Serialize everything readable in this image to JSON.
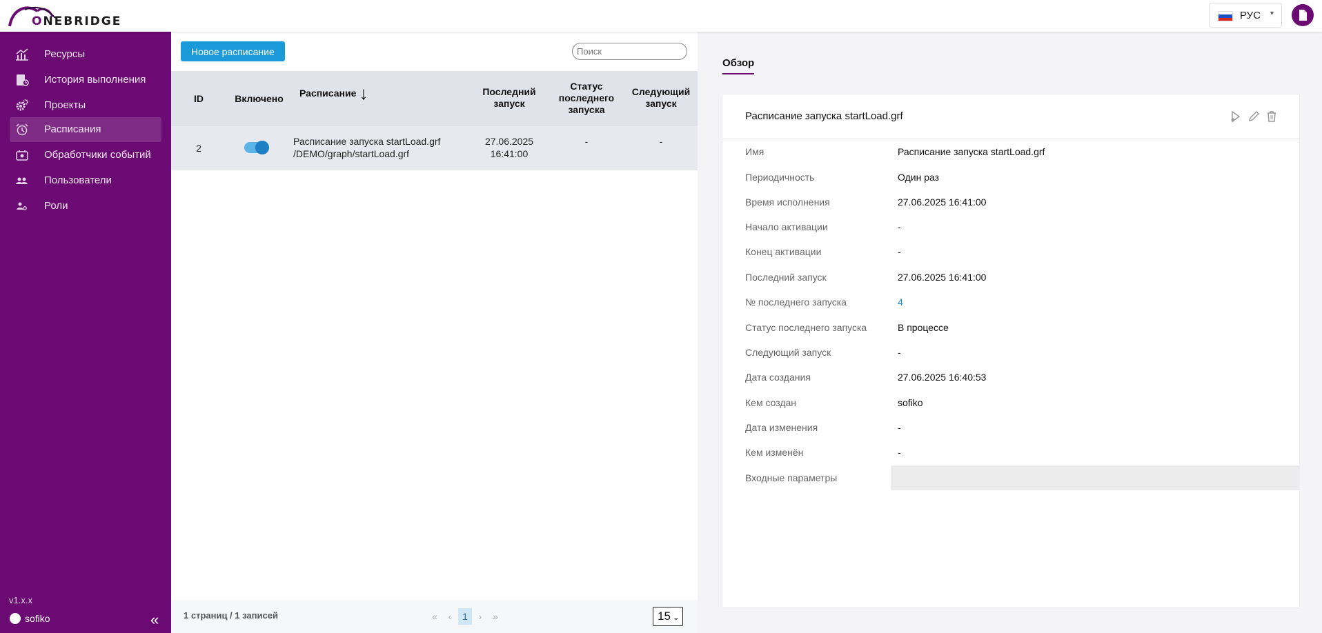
{
  "header": {
    "logo_text": "ONEBRIDGE",
    "language": "РУС",
    "flag_colors": [
      "#ffffff",
      "#1f4fc4",
      "#d52b1e"
    ],
    "doc_icon": "document-icon"
  },
  "colors": {
    "brand": "#6b0a73",
    "accent": "#1a9ad9"
  },
  "sidebar": {
    "items": [
      {
        "label": "Ресурсы",
        "icon": "chart-icon"
      },
      {
        "label": "История выполнения",
        "icon": "history-icon"
      },
      {
        "label": "Проекты",
        "icon": "gears-icon"
      },
      {
        "label": "Расписания",
        "icon": "alarm-clock-icon",
        "active": true
      },
      {
        "label": "Обработчики событий",
        "icon": "event-icon"
      },
      {
        "label": "Пользователи",
        "icon": "users-icon"
      },
      {
        "label": "Роли",
        "icon": "role-icon"
      }
    ],
    "version": "v1.x.x",
    "username": "sofiko",
    "collapse_glyph": "«"
  },
  "list": {
    "new_button": "Новое расписание",
    "search_placeholder": "Поиск",
    "columns": {
      "id": "ID",
      "enabled": "Включено",
      "schedule": "Расписание",
      "last_run_1": "Последний",
      "last_run_2": "запуск",
      "status_1": "Статус",
      "status_2": "последнего",
      "status_3": "запуска",
      "next_1": "Следующий",
      "next_2": "запуск"
    },
    "rows": [
      {
        "id": "2",
        "enabled": true,
        "name": "Расписание запуска startLoad.grf",
        "path": "/DEMO/graph/startLoad.grf",
        "last_date": "27.06.2025",
        "last_time": "16:41:00",
        "status": "-",
        "next": "-"
      }
    ]
  },
  "pagination": {
    "info": "1 страниц / 1 записей",
    "first": "«",
    "prev": "‹",
    "current": "1",
    "next": "›",
    "last": "»",
    "per_page": "15"
  },
  "details": {
    "tab": "Обзор",
    "title": "Расписание запуска startLoad.grf",
    "actions": [
      "run-icon",
      "edit-icon",
      "delete-icon"
    ],
    "fields": [
      {
        "label": "Имя",
        "value": "Расписание запуска startLoad.grf"
      },
      {
        "label": "Периодичность",
        "value": "Один раз"
      },
      {
        "label": "Время исполнения",
        "value": "27.06.2025 16:41:00"
      },
      {
        "label": "Начало активации",
        "value": "-"
      },
      {
        "label": "Конец активации",
        "value": "-"
      },
      {
        "label": "Последний запуск",
        "value": "27.06.2025 16:41:00"
      },
      {
        "label": "№ последнего запуска",
        "value": "4"
      },
      {
        "label": "Статус последнего запуска",
        "value": "В процессе"
      },
      {
        "label": "Следующий запуск",
        "value": "-"
      },
      {
        "label": "Дата создания",
        "value": "27.06.2025 16:40:53"
      },
      {
        "label": "Кем создан",
        "value": "sofiko"
      },
      {
        "label": "Дата изменения",
        "value": "-"
      },
      {
        "label": "Кем изменён",
        "value": "-"
      },
      {
        "label": "Входные параметры",
        "value": ""
      }
    ]
  }
}
